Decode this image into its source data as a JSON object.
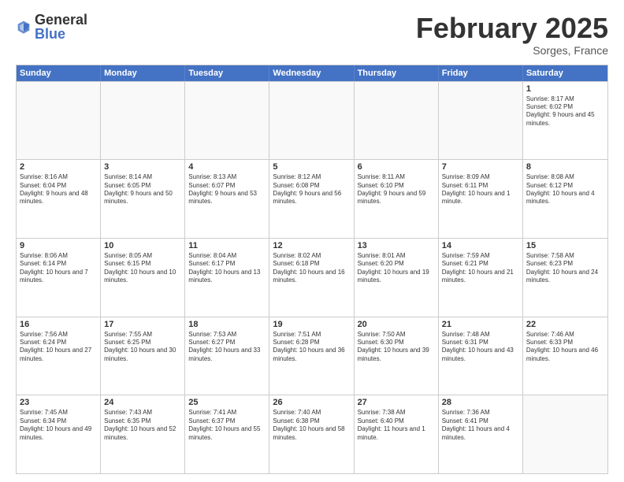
{
  "logo": {
    "general": "General",
    "blue": "Blue"
  },
  "title": "February 2025",
  "subtitle": "Sorges, France",
  "header": {
    "days": [
      "Sunday",
      "Monday",
      "Tuesday",
      "Wednesday",
      "Thursday",
      "Friday",
      "Saturday"
    ]
  },
  "weeks": [
    [
      {
        "day": "",
        "info": ""
      },
      {
        "day": "",
        "info": ""
      },
      {
        "day": "",
        "info": ""
      },
      {
        "day": "",
        "info": ""
      },
      {
        "day": "",
        "info": ""
      },
      {
        "day": "",
        "info": ""
      },
      {
        "day": "1",
        "info": "Sunrise: 8:17 AM\nSunset: 6:02 PM\nDaylight: 9 hours and 45 minutes."
      }
    ],
    [
      {
        "day": "2",
        "info": "Sunrise: 8:16 AM\nSunset: 6:04 PM\nDaylight: 9 hours and 48 minutes."
      },
      {
        "day": "3",
        "info": "Sunrise: 8:14 AM\nSunset: 6:05 PM\nDaylight: 9 hours and 50 minutes."
      },
      {
        "day": "4",
        "info": "Sunrise: 8:13 AM\nSunset: 6:07 PM\nDaylight: 9 hours and 53 minutes."
      },
      {
        "day": "5",
        "info": "Sunrise: 8:12 AM\nSunset: 6:08 PM\nDaylight: 9 hours and 56 minutes."
      },
      {
        "day": "6",
        "info": "Sunrise: 8:11 AM\nSunset: 6:10 PM\nDaylight: 9 hours and 59 minutes."
      },
      {
        "day": "7",
        "info": "Sunrise: 8:09 AM\nSunset: 6:11 PM\nDaylight: 10 hours and 1 minute."
      },
      {
        "day": "8",
        "info": "Sunrise: 8:08 AM\nSunset: 6:12 PM\nDaylight: 10 hours and 4 minutes."
      }
    ],
    [
      {
        "day": "9",
        "info": "Sunrise: 8:06 AM\nSunset: 6:14 PM\nDaylight: 10 hours and 7 minutes."
      },
      {
        "day": "10",
        "info": "Sunrise: 8:05 AM\nSunset: 6:15 PM\nDaylight: 10 hours and 10 minutes."
      },
      {
        "day": "11",
        "info": "Sunrise: 8:04 AM\nSunset: 6:17 PM\nDaylight: 10 hours and 13 minutes."
      },
      {
        "day": "12",
        "info": "Sunrise: 8:02 AM\nSunset: 6:18 PM\nDaylight: 10 hours and 16 minutes."
      },
      {
        "day": "13",
        "info": "Sunrise: 8:01 AM\nSunset: 6:20 PM\nDaylight: 10 hours and 19 minutes."
      },
      {
        "day": "14",
        "info": "Sunrise: 7:59 AM\nSunset: 6:21 PM\nDaylight: 10 hours and 21 minutes."
      },
      {
        "day": "15",
        "info": "Sunrise: 7:58 AM\nSunset: 6:23 PM\nDaylight: 10 hours and 24 minutes."
      }
    ],
    [
      {
        "day": "16",
        "info": "Sunrise: 7:56 AM\nSunset: 6:24 PM\nDaylight: 10 hours and 27 minutes."
      },
      {
        "day": "17",
        "info": "Sunrise: 7:55 AM\nSunset: 6:25 PM\nDaylight: 10 hours and 30 minutes."
      },
      {
        "day": "18",
        "info": "Sunrise: 7:53 AM\nSunset: 6:27 PM\nDaylight: 10 hours and 33 minutes."
      },
      {
        "day": "19",
        "info": "Sunrise: 7:51 AM\nSunset: 6:28 PM\nDaylight: 10 hours and 36 minutes."
      },
      {
        "day": "20",
        "info": "Sunrise: 7:50 AM\nSunset: 6:30 PM\nDaylight: 10 hours and 39 minutes."
      },
      {
        "day": "21",
        "info": "Sunrise: 7:48 AM\nSunset: 6:31 PM\nDaylight: 10 hours and 43 minutes."
      },
      {
        "day": "22",
        "info": "Sunrise: 7:46 AM\nSunset: 6:33 PM\nDaylight: 10 hours and 46 minutes."
      }
    ],
    [
      {
        "day": "23",
        "info": "Sunrise: 7:45 AM\nSunset: 6:34 PM\nDaylight: 10 hours and 49 minutes."
      },
      {
        "day": "24",
        "info": "Sunrise: 7:43 AM\nSunset: 6:35 PM\nDaylight: 10 hours and 52 minutes."
      },
      {
        "day": "25",
        "info": "Sunrise: 7:41 AM\nSunset: 6:37 PM\nDaylight: 10 hours and 55 minutes."
      },
      {
        "day": "26",
        "info": "Sunrise: 7:40 AM\nSunset: 6:38 PM\nDaylight: 10 hours and 58 minutes."
      },
      {
        "day": "27",
        "info": "Sunrise: 7:38 AM\nSunset: 6:40 PM\nDaylight: 11 hours and 1 minute."
      },
      {
        "day": "28",
        "info": "Sunrise: 7:36 AM\nSunset: 6:41 PM\nDaylight: 11 hours and 4 minutes."
      },
      {
        "day": "",
        "info": ""
      }
    ]
  ]
}
